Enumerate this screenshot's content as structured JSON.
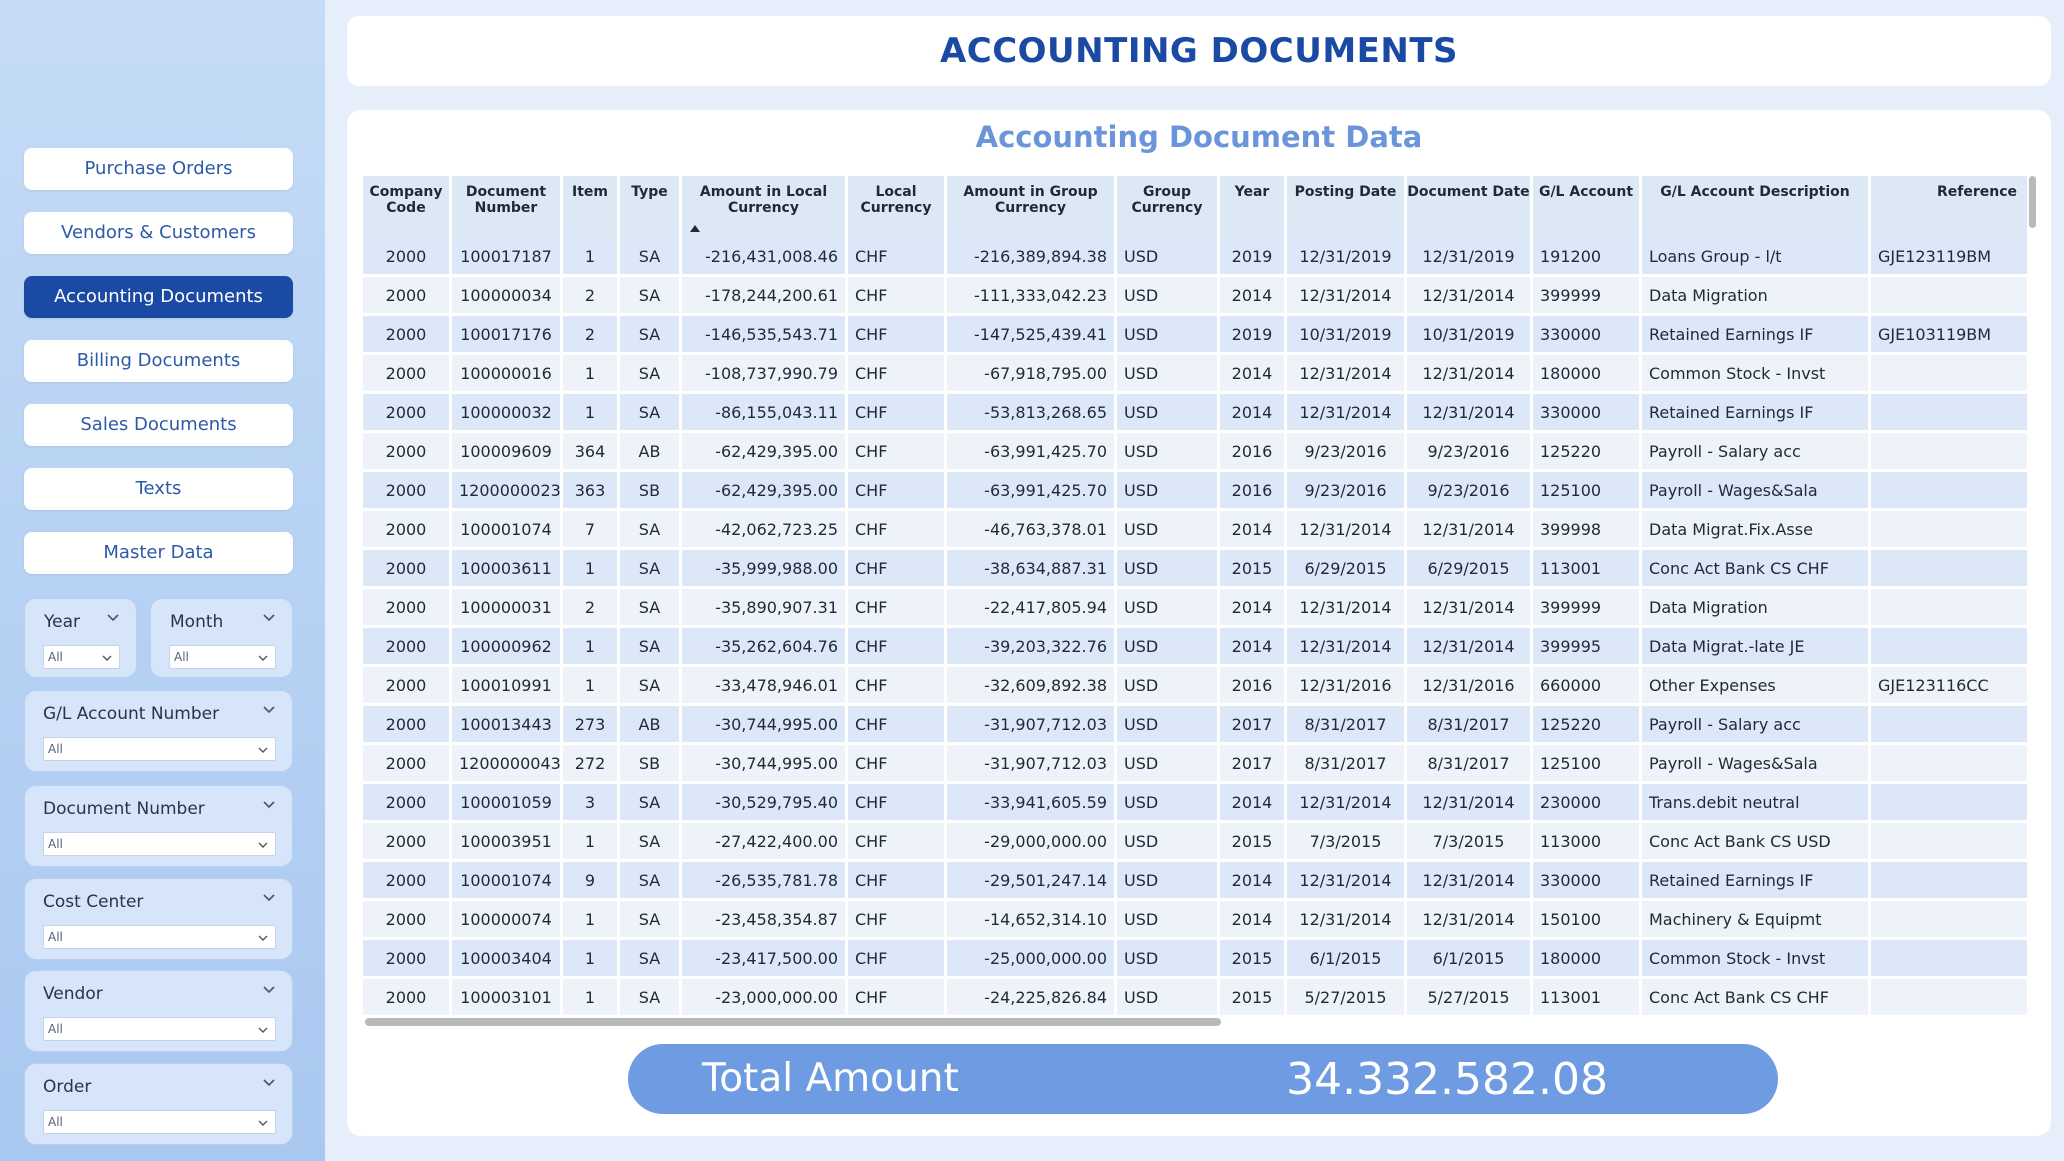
{
  "header": {
    "title": "ACCOUNTING DOCUMENTS"
  },
  "nav": {
    "items": [
      {
        "label": "Purchase Orders"
      },
      {
        "label": "Vendors & Customers"
      },
      {
        "label": "Accounting Documents",
        "active": true
      },
      {
        "label": "Billing Documents"
      },
      {
        "label": "Sales Documents"
      },
      {
        "label": "Texts"
      },
      {
        "label": "Master Data"
      }
    ]
  },
  "filters": {
    "year": {
      "label": "Year",
      "value": "All"
    },
    "month": {
      "label": "Month",
      "value": "All"
    },
    "gl_account": {
      "label": "G/L Account Number",
      "value": "All"
    },
    "document_number": {
      "label": "Document Number",
      "value": "All"
    },
    "cost_center": {
      "label": "Cost Center",
      "value": "All"
    },
    "vendor": {
      "label": "Vendor",
      "value": "All"
    },
    "order": {
      "label": "Order",
      "value": "All"
    }
  },
  "table": {
    "title": "Accounting Document Data",
    "headers": [
      "Company Code",
      "Document Number",
      "Item",
      "Type",
      "Amount in Local Currency",
      "Local Currency",
      "Amount in Group Currency",
      "Group Currency",
      "Year",
      "Posting Date",
      "Document Date",
      "G/L Account",
      "G/L Account Description",
      "Reference"
    ],
    "rows": [
      [
        "2000",
        "100017187",
        "1",
        "SA",
        "-216,431,008.46",
        "CHF",
        "-216,389,894.38",
        "USD",
        "2019",
        "12/31/2019",
        "12/31/2019",
        "191200",
        "Loans Group - l/t",
        "GJE123119BM"
      ],
      [
        "2000",
        "100000034",
        "2",
        "SA",
        "-178,244,200.61",
        "CHF",
        "-111,333,042.23",
        "USD",
        "2014",
        "12/31/2014",
        "12/31/2014",
        "399999",
        "Data Migration",
        ""
      ],
      [
        "2000",
        "100017176",
        "2",
        "SA",
        "-146,535,543.71",
        "CHF",
        "-147,525,439.41",
        "USD",
        "2019",
        "10/31/2019",
        "10/31/2019",
        "330000",
        "Retained Earnings IF",
        "GJE103119BM"
      ],
      [
        "2000",
        "100000016",
        "1",
        "SA",
        "-108,737,990.79",
        "CHF",
        "-67,918,795.00",
        "USD",
        "2014",
        "12/31/2014",
        "12/31/2014",
        "180000",
        "Common Stock - Invst",
        ""
      ],
      [
        "2000",
        "100000032",
        "1",
        "SA",
        "-86,155,043.11",
        "CHF",
        "-53,813,268.65",
        "USD",
        "2014",
        "12/31/2014",
        "12/31/2014",
        "330000",
        "Retained Earnings IF",
        ""
      ],
      [
        "2000",
        "100009609",
        "364",
        "AB",
        "-62,429,395.00",
        "CHF",
        "-63,991,425.70",
        "USD",
        "2016",
        "9/23/2016",
        "9/23/2016",
        "125220",
        "Payroll - Salary acc",
        ""
      ],
      [
        "2000",
        "1200000023",
        "363",
        "SB",
        "-62,429,395.00",
        "CHF",
        "-63,991,425.70",
        "USD",
        "2016",
        "9/23/2016",
        "9/23/2016",
        "125100",
        "Payroll - Wages&Sala",
        ""
      ],
      [
        "2000",
        "100001074",
        "7",
        "SA",
        "-42,062,723.25",
        "CHF",
        "-46,763,378.01",
        "USD",
        "2014",
        "12/31/2014",
        "12/31/2014",
        "399998",
        "Data Migrat.Fix.Asse",
        ""
      ],
      [
        "2000",
        "100003611",
        "1",
        "SA",
        "-35,999,988.00",
        "CHF",
        "-38,634,887.31",
        "USD",
        "2015",
        "6/29/2015",
        "6/29/2015",
        "113001",
        "Conc Act Bank CS CHF",
        ""
      ],
      [
        "2000",
        "100000031",
        "2",
        "SA",
        "-35,890,907.31",
        "CHF",
        "-22,417,805.94",
        "USD",
        "2014",
        "12/31/2014",
        "12/31/2014",
        "399999",
        "Data Migration",
        ""
      ],
      [
        "2000",
        "100000962",
        "1",
        "SA",
        "-35,262,604.76",
        "CHF",
        "-39,203,322.76",
        "USD",
        "2014",
        "12/31/2014",
        "12/31/2014",
        "399995",
        "Data Migrat.-late JE",
        ""
      ],
      [
        "2000",
        "100010991",
        "1",
        "SA",
        "-33,478,946.01",
        "CHF",
        "-32,609,892.38",
        "USD",
        "2016",
        "12/31/2016",
        "12/31/2016",
        "660000",
        "Other Expenses",
        "GJE123116CC"
      ],
      [
        "2000",
        "100013443",
        "273",
        "AB",
        "-30,744,995.00",
        "CHF",
        "-31,907,712.03",
        "USD",
        "2017",
        "8/31/2017",
        "8/31/2017",
        "125220",
        "Payroll - Salary acc",
        ""
      ],
      [
        "2000",
        "1200000043",
        "272",
        "SB",
        "-30,744,995.00",
        "CHF",
        "-31,907,712.03",
        "USD",
        "2017",
        "8/31/2017",
        "8/31/2017",
        "125100",
        "Payroll - Wages&Sala",
        ""
      ],
      [
        "2000",
        "100001059",
        "3",
        "SA",
        "-30,529,795.40",
        "CHF",
        "-33,941,605.59",
        "USD",
        "2014",
        "12/31/2014",
        "12/31/2014",
        "230000",
        "Trans.debit neutral",
        ""
      ],
      [
        "2000",
        "100003951",
        "1",
        "SA",
        "-27,422,400.00",
        "CHF",
        "-29,000,000.00",
        "USD",
        "2015",
        "7/3/2015",
        "7/3/2015",
        "113000",
        "Conc Act Bank CS USD",
        ""
      ],
      [
        "2000",
        "100001074",
        "9",
        "SA",
        "-26,535,781.78",
        "CHF",
        "-29,501,247.14",
        "USD",
        "2014",
        "12/31/2014",
        "12/31/2014",
        "330000",
        "Retained Earnings IF",
        ""
      ],
      [
        "2000",
        "100000074",
        "1",
        "SA",
        "-23,458,354.87",
        "CHF",
        "-14,652,314.10",
        "USD",
        "2014",
        "12/31/2014",
        "12/31/2014",
        "150100",
        "Machinery & Equipmt",
        ""
      ],
      [
        "2000",
        "100003404",
        "1",
        "SA",
        "-23,417,500.00",
        "CHF",
        "-25,000,000.00",
        "USD",
        "2015",
        "6/1/2015",
        "6/1/2015",
        "180000",
        "Common Stock - Invst",
        ""
      ],
      [
        "2000",
        "100003101",
        "1",
        "SA",
        "-23,000,000.00",
        "CHF",
        "-24,225,826.84",
        "USD",
        "2015",
        "5/27/2015",
        "5/27/2015",
        "113001",
        "Conc Act Bank CS CHF",
        ""
      ]
    ]
  },
  "total": {
    "label": "Total Amount",
    "value": "34.332.582.08"
  },
  "colors": {
    "accent": "#1a4aa3",
    "pill": "#6e9be1",
    "title_light": "#6a95da"
  }
}
